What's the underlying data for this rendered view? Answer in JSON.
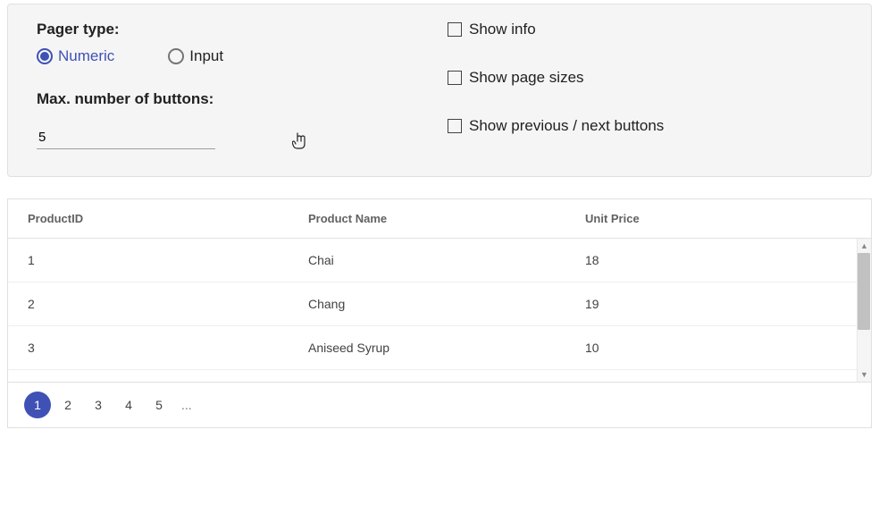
{
  "config": {
    "pager_type_label": "Pager type:",
    "radio_numeric": "Numeric",
    "radio_input": "Input",
    "max_buttons_label": "Max. number of buttons:",
    "max_buttons_value": "5",
    "check_show_info": "Show info",
    "check_show_page_sizes": "Show page sizes",
    "check_show_prev_next": "Show previous / next buttons"
  },
  "grid": {
    "headers": {
      "c0": "ProductID",
      "c1": "Product Name",
      "c2": "Unit Price"
    },
    "rows": [
      {
        "c0": "1",
        "c1": "Chai",
        "c2": "18"
      },
      {
        "c0": "2",
        "c1": "Chang",
        "c2": "19"
      },
      {
        "c0": "3",
        "c1": "Aniseed Syrup",
        "c2": "10"
      }
    ]
  },
  "pager": {
    "pages": [
      "1",
      "2",
      "3",
      "4",
      "5"
    ],
    "ellipsis": "..."
  }
}
